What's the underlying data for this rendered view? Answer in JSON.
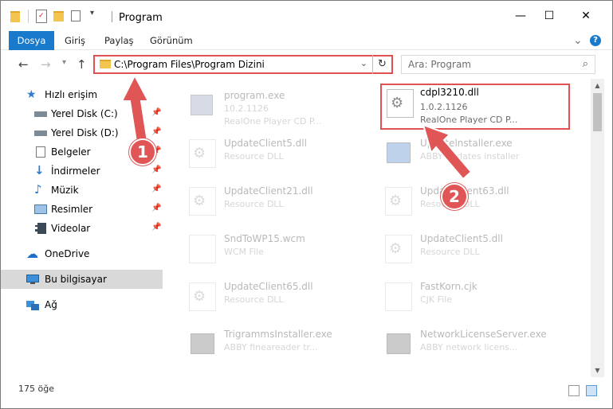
{
  "window": {
    "title": "Program",
    "minimize": "—",
    "maximize": "☐",
    "close": "✕"
  },
  "ribbon": {
    "tabs": [
      "Dosya",
      "Giriş",
      "Paylaş",
      "Görünüm"
    ],
    "expand": "⌄",
    "help": "?"
  },
  "address": {
    "path": "C:\\Program Files\\Program Dizini",
    "search_placeholder": "Ara: Program"
  },
  "sidebar": {
    "quick_access": "Hızlı erişim",
    "items": [
      {
        "label": "Yerel Disk (C:)",
        "icon": "drive-icon"
      },
      {
        "label": "Yerel Disk (D:)",
        "icon": "drive-icon"
      },
      {
        "label": "Belgeler",
        "icon": "documents-icon"
      },
      {
        "label": "İndirmeler",
        "icon": "downloads-icon"
      },
      {
        "label": "Müzik",
        "icon": "music-icon"
      },
      {
        "label": "Resimler",
        "icon": "pictures-icon"
      },
      {
        "label": "Videolar",
        "icon": "videos-icon"
      }
    ],
    "onedrive": "OneDrive",
    "this_pc": "Bu bilgisayar",
    "network": "Ağ"
  },
  "files": [
    {
      "name": "program.exe",
      "version": "10.2.1126",
      "desc": "RealOne Player CD P...",
      "faded": true
    },
    {
      "name": "cdpl3210.dll",
      "version": "1.0.2.1126",
      "desc": "RealOne Player CD P...",
      "faded": false
    },
    {
      "name": "UpdateClient5.dll",
      "version": "Resource DLL",
      "desc": "",
      "faded": true
    },
    {
      "name": "Updatelnstaller.exe",
      "version": "ABBY updates installer",
      "desc": "",
      "faded": true
    },
    {
      "name": "UpdateClient21.dll",
      "version": "Resource DLL",
      "desc": "",
      "faded": true
    },
    {
      "name": "UpdateClient63.dll",
      "version": "Resource DLL",
      "desc": "",
      "faded": true
    },
    {
      "name": "SndToWP15.wcm",
      "version": "WCM File",
      "desc": "",
      "faded": true
    },
    {
      "name": "UpdateClient5.dll",
      "version": "Resource DLL",
      "desc": "",
      "faded": true
    },
    {
      "name": "UpdateClient65.dll",
      "version": "Resource DLL",
      "desc": "",
      "faded": true
    },
    {
      "name": "FastKorn.cjk",
      "version": "CJK File",
      "desc": "",
      "faded": true
    },
    {
      "name": "TrigrammsInstaller.exe",
      "version": "ABBY fineareader tr...",
      "desc": "",
      "faded": true
    },
    {
      "name": "NetworkLicenseServer.exe",
      "version": "ABBY network licens...",
      "desc": "",
      "faded": true
    }
  ],
  "status": {
    "count": "175 öğe"
  },
  "annotations": [
    "1",
    "2"
  ],
  "colors": {
    "accent": "#1979ca",
    "highlight": "#e05050"
  }
}
